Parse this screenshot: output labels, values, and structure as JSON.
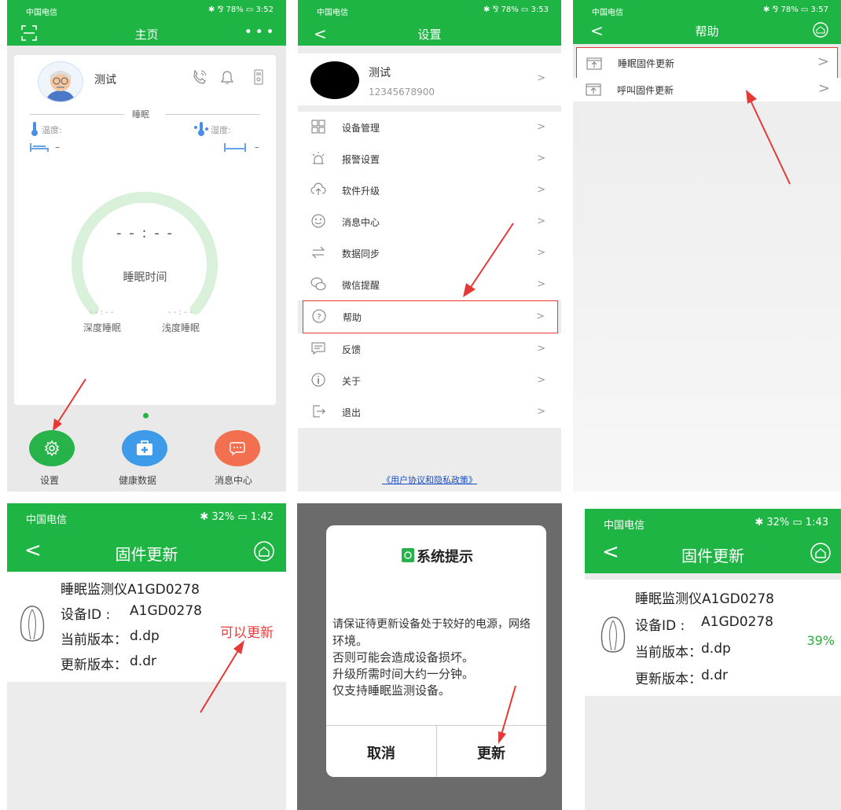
{
  "screens": {
    "home": {
      "status_left": "中国电信",
      "status_right": "✱ ⅋ 78% ▭ 3:52",
      "title": "主页",
      "more": "• • •",
      "profile_name": "测试",
      "section": "睡眠",
      "temp_label": "温度:",
      "humidity_label": "湿度:",
      "left_val": "–",
      "right_val": "–",
      "time_value": "- - : - -",
      "time_label": "睡眠时间",
      "deep_value": "- - : - -",
      "deep_label": "深度睡眠",
      "light_value": "- - : - -",
      "light_label": "浅度睡眠",
      "bottom": [
        "设置",
        "健康数据",
        "消息中心"
      ],
      "colors": {
        "green": "#27b24a",
        "blue": "#3d9be9",
        "orange": "#f2704f",
        "arc": "#d9f0da"
      }
    },
    "settings": {
      "status_left": "中国电信",
      "status_right": "✱ ⅋ 78% ▭ 3:53",
      "title": "设置",
      "profile_name": "测试",
      "phone": "12345678900",
      "items": [
        "设备管理",
        "报警设置",
        "软件升级",
        "消息中心",
        "数据同步",
        "微信提醒",
        "帮助",
        "反馈",
        "关于",
        "退出"
      ],
      "policy": "《用户协议和隐私政策》"
    },
    "help": {
      "status_left": "中国电信",
      "status_right": "✱ ⅋ 78% ▭ 3:57",
      "title": "帮助",
      "items": [
        "睡眠固件更新",
        "呼叫固件更新"
      ]
    },
    "firmware1": {
      "status_left": "中国电信",
      "status_right": "✱ 32% ▭ 1:42",
      "title": "固件更新",
      "device_name": "睡眠监测仪A1GD0278",
      "id_label": "设备ID :",
      "id_value": "A1GD0278",
      "cur_label": "当前版本：",
      "cur_value": "d.dp",
      "new_label": "更新版本：",
      "new_value": "d.dr",
      "action": "可以更新"
    },
    "dialog": {
      "title": "系统提示",
      "lines": [
        "请保证待更新设备处于较好的电源，网络",
        "环境。",
        "否则可能会造成设备损坏。",
        "升级所需时间大约一分钟。",
        "仅支持睡眠监测设备。"
      ],
      "cancel": "取消",
      "confirm": "更新"
    },
    "firmware2": {
      "status_left": "中国电信",
      "status_right": "✱ 32% ▭ 1:43",
      "title": "固件更新",
      "device_name": "睡眠监测仪A1GD0278",
      "id_label": "设备ID :",
      "id_value": "A1GD0278",
      "cur_label": "当前版本：",
      "cur_value": "d.dp",
      "new_label": "更新版本：",
      "new_value": "d.dr",
      "progress": "39%"
    }
  }
}
